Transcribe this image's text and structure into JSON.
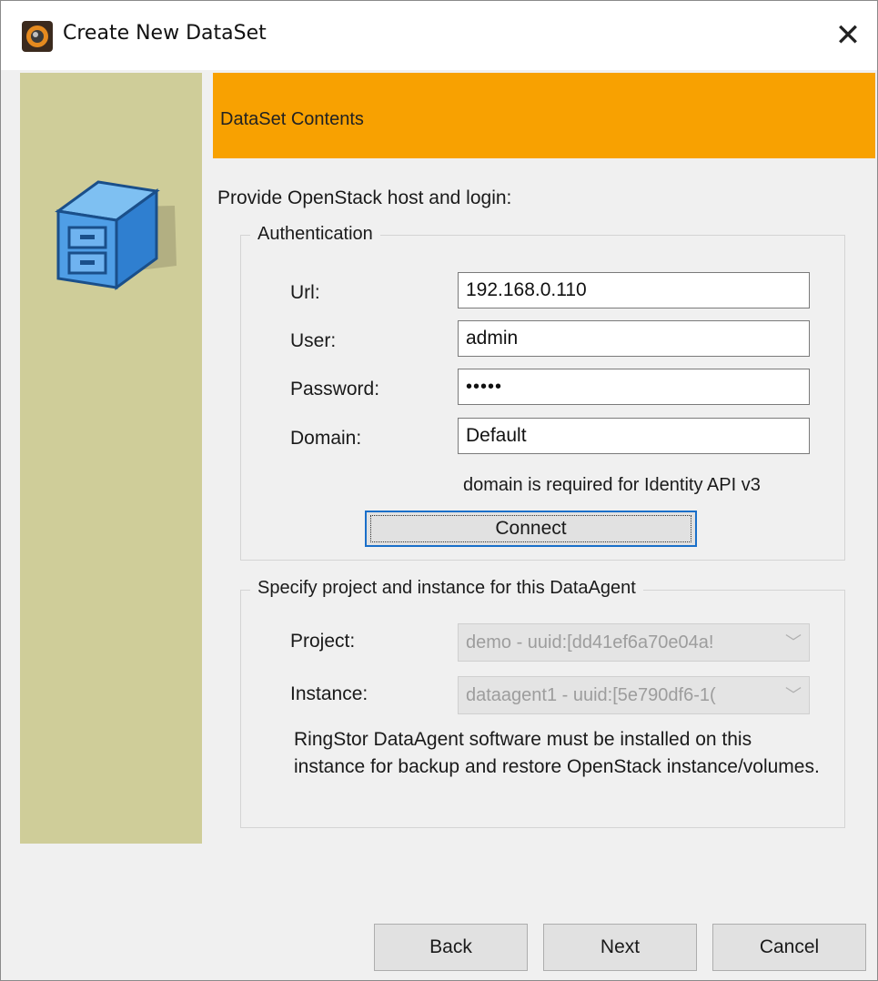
{
  "window": {
    "title": "Create New DataSet"
  },
  "header": {
    "title": "DataSet Contents"
  },
  "prompt": "Provide OpenStack host and login:",
  "auth": {
    "legend": "Authentication",
    "url_label": "Url:",
    "url_value": "192.168.0.110",
    "user_label": "User:",
    "user_value": "admin",
    "password_label": "Password:",
    "password_value": "•••••",
    "domain_label": "Domain:",
    "domain_value": "Default",
    "domain_hint": "domain is required for Identity API v3",
    "connect_label": "Connect"
  },
  "project_group": {
    "legend": "Specify project and instance for this DataAgent",
    "project_label": "Project:",
    "project_value": "demo - uuid:[dd41ef6a70e04a!",
    "instance_label": "Instance:",
    "instance_value": "dataagent1 - uuid:[5e790df6-1(",
    "note": "RingStor DataAgent software must be installed on this instance for backup and restore OpenStack instance/volumes."
  },
  "footer": {
    "back_label": "Back",
    "next_label": "Next",
    "cancel_label": "Cancel"
  },
  "icons": {
    "app": "app-logo-icon",
    "close": "close-icon",
    "side": "file-cabinet-icon",
    "dropdown": "chevron-down-icon"
  },
  "colors": {
    "header_band": "#f8a101",
    "side_panel": "#cfcd99",
    "focus_border": "#1a6fc9"
  }
}
